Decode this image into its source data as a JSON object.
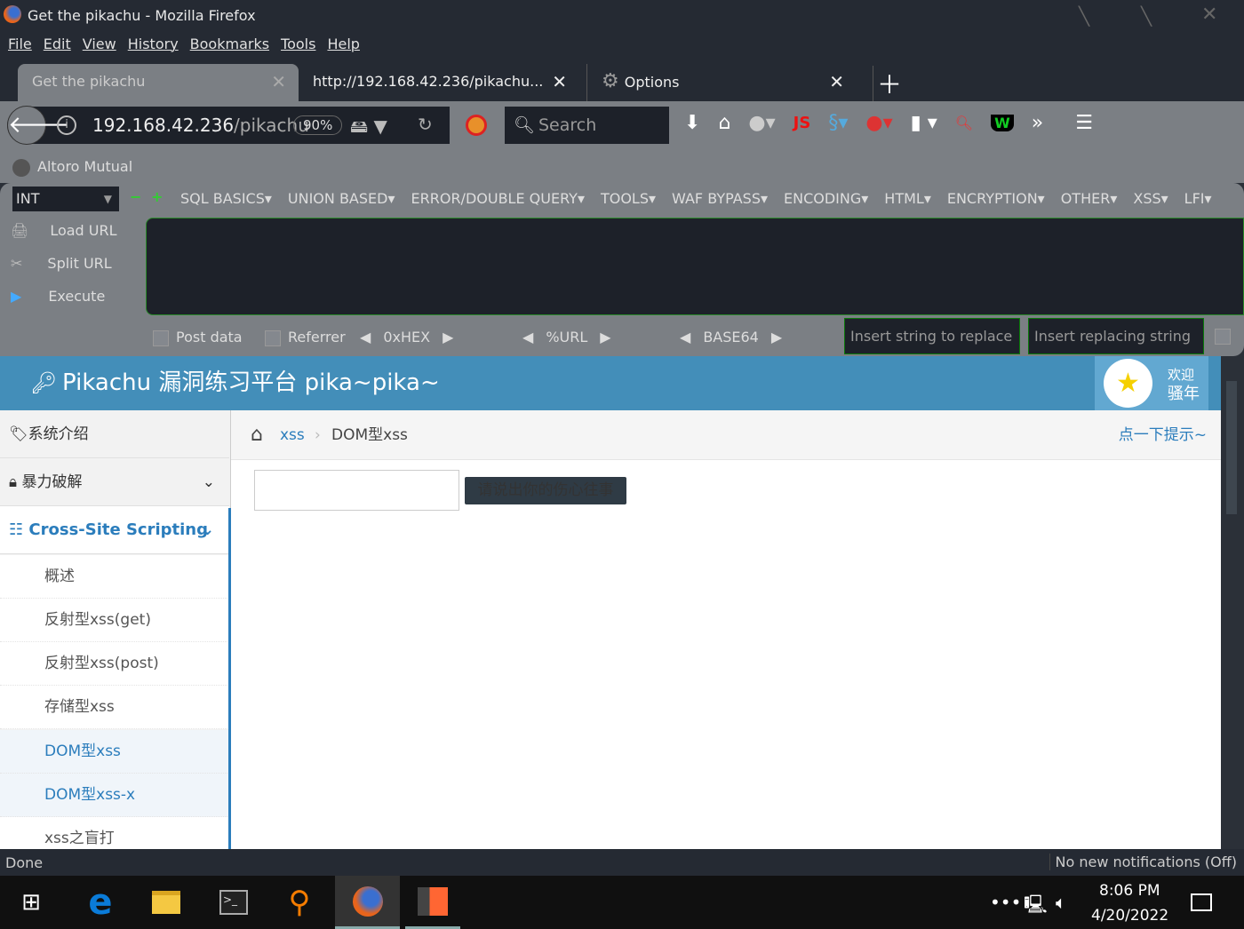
{
  "window": {
    "title": "Get the pikachu - Mozilla Firefox"
  },
  "menu": [
    "File",
    "Edit",
    "View",
    "History",
    "Bookmarks",
    "Tools",
    "Help"
  ],
  "tabs": [
    {
      "label": "Get the pikachu"
    },
    {
      "label": "http://192.168.42.236/pikachu..."
    },
    {
      "label": "Options"
    }
  ],
  "nav": {
    "url_host": "192.168.42.236",
    "url_path": "/pikachu",
    "zoom": "90%",
    "search_placeholder": "Search"
  },
  "bookmarks": [
    {
      "label": "Altoro Mutual"
    }
  ],
  "hackbar": {
    "type": "INT",
    "menus": [
      "SQL BASICS",
      "UNION BASED",
      "ERROR/DOUBLE QUERY",
      "TOOLS",
      "WAF BYPASS",
      "ENCODING",
      "HTML",
      "ENCRYPTION",
      "OTHER",
      "XSS",
      "LFI"
    ],
    "actions": [
      "Load URL",
      "Split URL",
      "Execute"
    ],
    "options": [
      "Post data",
      "Referrer",
      "0xHEX",
      "%URL",
      "BASE64"
    ],
    "replace_placeholder": "Insert string to replace",
    "replacing_placeholder": "Insert replacing string"
  },
  "site": {
    "title": "Pikachu 漏洞练习平台 pika~pika~",
    "welcome": "欢迎",
    "user": "骚年",
    "sidebar": [
      {
        "label": "系统介绍"
      },
      {
        "label": "暴力破解"
      },
      {
        "label": "Cross-Site Scripting"
      }
    ],
    "subitems": [
      {
        "label": "概述"
      },
      {
        "label": "反射型xss(get)"
      },
      {
        "label": "反射型xss(post)"
      },
      {
        "label": "存储型xss"
      },
      {
        "label": "DOM型xss",
        "active": true
      },
      {
        "label": "DOM型xss-x",
        "active": true
      },
      {
        "label": "xss之盲打"
      }
    ],
    "breadcrumb": {
      "parent": "xss",
      "current": "DOM型xss",
      "hint": "点一下提示~"
    },
    "input_value": "",
    "button_label": "请说出你的伤心往事"
  },
  "status": {
    "text": "Done",
    "notifications": "No new notifications (Off)"
  },
  "taskbar": {
    "time": "8:06 PM",
    "date": "4/20/2022"
  },
  "colors": {
    "header": "#438eb9",
    "accent": "#2b7dbc"
  }
}
